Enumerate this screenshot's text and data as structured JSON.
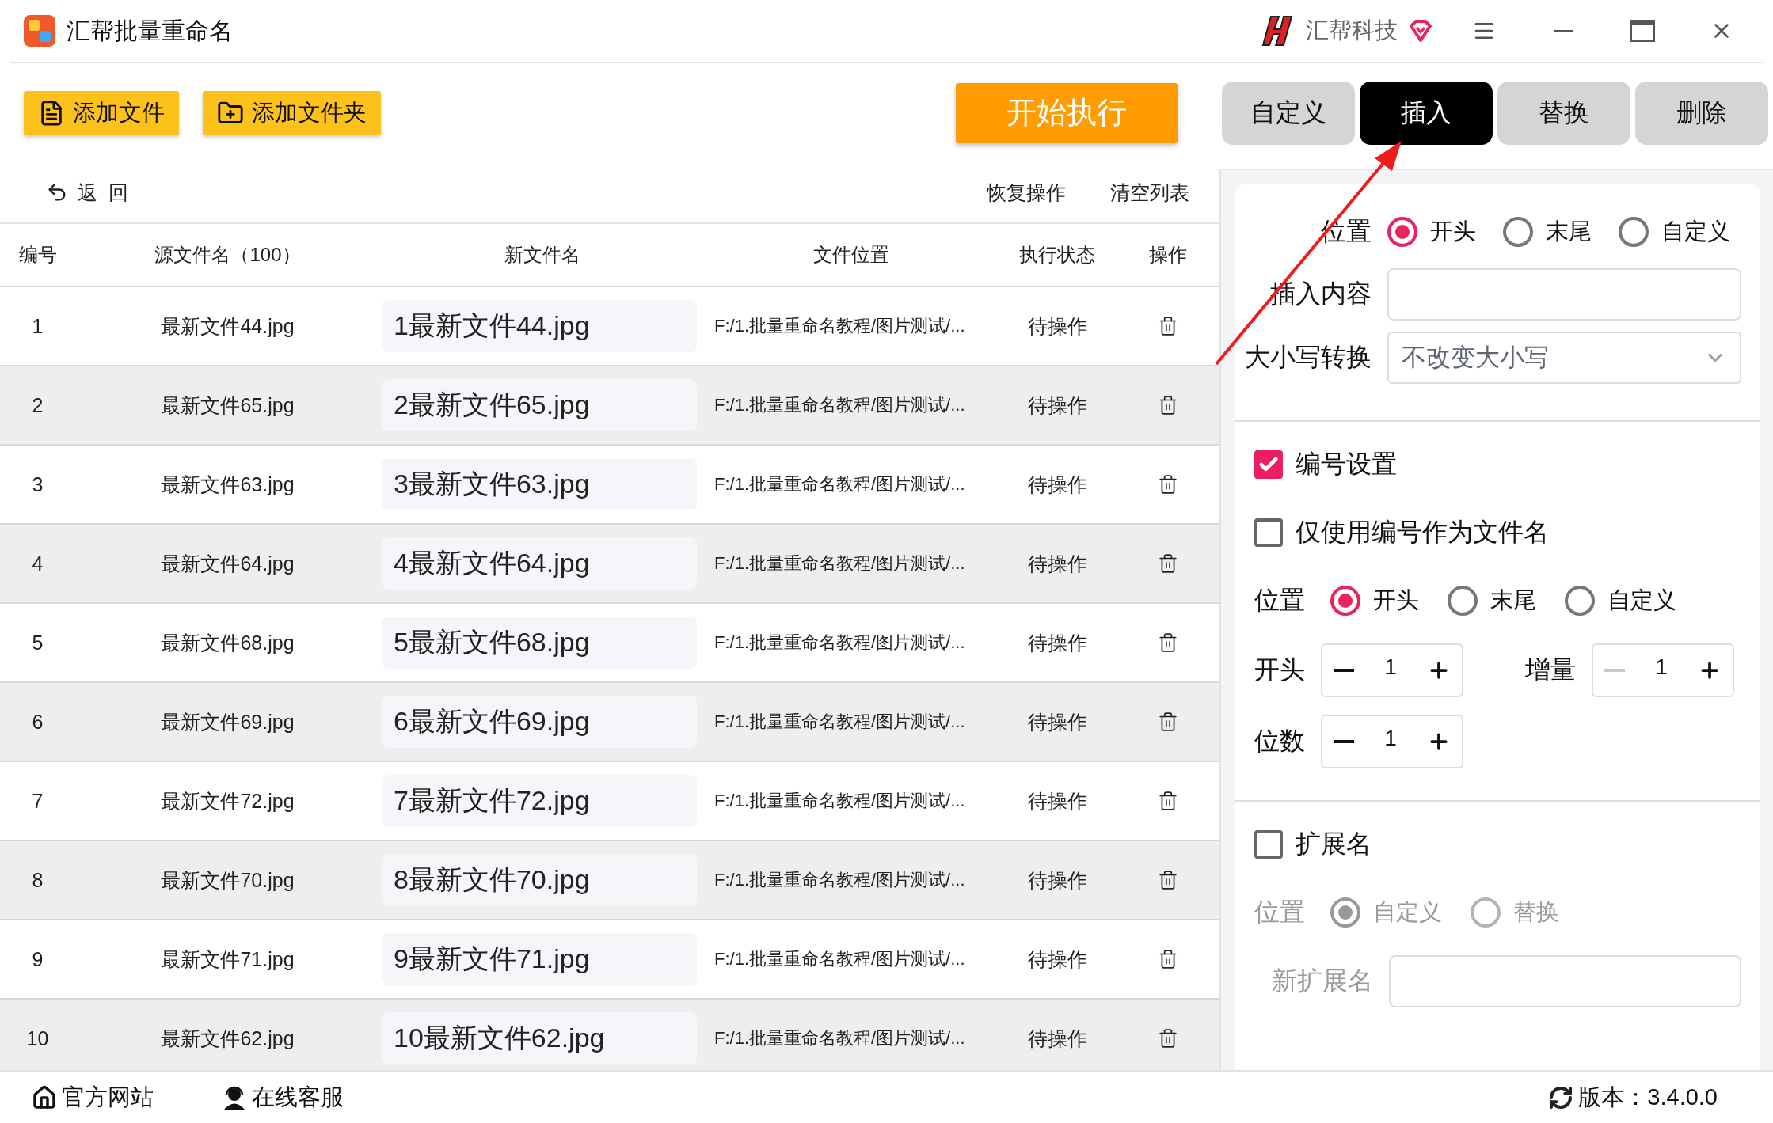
{
  "window": {
    "title": "汇帮批量重命名",
    "brand": "汇帮科技"
  },
  "toolbar": {
    "buttons": [
      "添加文件",
      "添加文件夹"
    ],
    "run_button": "开始执行"
  },
  "mode_tabs": [
    {
      "label": "自定义",
      "selected": false
    },
    {
      "label": "插入",
      "selected": true
    },
    {
      "label": "替换",
      "selected": false
    },
    {
      "label": "删除",
      "selected": false
    }
  ],
  "list_actions": {
    "back": "返  回",
    "undo": "恢复操作",
    "clear": "清空列表"
  },
  "table": {
    "columns": [
      "编号",
      "源文件名（100）",
      "新文件名",
      "文件位置",
      "执行状态",
      "操作"
    ],
    "rows": [
      {
        "index": "1",
        "source": "最新文件44.jpg",
        "new_name": "1最新文件44.jpg",
        "location": "F:/1.批量重命名教程/图片测试/...",
        "status": "待操作"
      },
      {
        "index": "2",
        "source": "最新文件65.jpg",
        "new_name": "2最新文件65.jpg",
        "location": "F:/1.批量重命名教程/图片测试/...",
        "status": "待操作"
      },
      {
        "index": "3",
        "source": "最新文件63.jpg",
        "new_name": "3最新文件63.jpg",
        "location": "F:/1.批量重命名教程/图片测试/...",
        "status": "待操作"
      },
      {
        "index": "4",
        "source": "最新文件64.jpg",
        "new_name": "4最新文件64.jpg",
        "location": "F:/1.批量重命名教程/图片测试/...",
        "status": "待操作"
      },
      {
        "index": "5",
        "source": "最新文件68.jpg",
        "new_name": "5最新文件68.jpg",
        "location": "F:/1.批量重命名教程/图片测试/...",
        "status": "待操作"
      },
      {
        "index": "6",
        "source": "最新文件69.jpg",
        "new_name": "6最新文件69.jpg",
        "location": "F:/1.批量重命名教程/图片测试/...",
        "status": "待操作"
      },
      {
        "index": "7",
        "source": "最新文件72.jpg",
        "new_name": "7最新文件72.jpg",
        "location": "F:/1.批量重命名教程/图片测试/...",
        "status": "待操作"
      },
      {
        "index": "8",
        "source": "最新文件70.jpg",
        "new_name": "8最新文件70.jpg",
        "location": "F:/1.批量重命名教程/图片测试/...",
        "status": "待操作"
      },
      {
        "index": "9",
        "source": "最新文件71.jpg",
        "new_name": "9最新文件71.jpg",
        "location": "F:/1.批量重命名教程/图片测试/...",
        "status": "待操作"
      },
      {
        "index": "10",
        "source": "最新文件62.jpg",
        "new_name": "10最新文件62.jpg",
        "location": "F:/1.批量重命名教程/图片测试/...",
        "status": "待操作"
      }
    ]
  },
  "insert": {
    "position_label": "位置",
    "position": [
      {
        "label": "开头",
        "selected": true
      },
      {
        "label": "末尾",
        "selected": false
      },
      {
        "label": "自定义",
        "selected": false
      }
    ],
    "content_label": "插入内容",
    "case_label": "大小写转换",
    "case_value": "不改变大小写"
  },
  "numbering": {
    "label": "编号设置",
    "checked": true,
    "only_number_label": "仅使用编号作为文件名",
    "only_number_checked": false,
    "position_label": "位置",
    "position": [
      {
        "label": "开头",
        "selected": true
      },
      {
        "label": "末尾",
        "selected": false
      },
      {
        "label": "自定义",
        "selected": false
      }
    ],
    "start": {
      "label": "开头",
      "value": "1",
      "minus_disabled": false
    },
    "increment": {
      "label": "增量",
      "value": "1",
      "minus_disabled": true
    },
    "digits": {
      "label": "位数",
      "value": "1",
      "minus_disabled": false
    }
  },
  "extension": {
    "label": "扩展名",
    "checked": false,
    "position_label": "位置",
    "position": [
      {
        "label": "自定义",
        "selected": true
      },
      {
        "label": "替换",
        "selected": false
      }
    ],
    "new_label": "新扩展名"
  },
  "footer": {
    "links": [
      "官方网站",
      "在线客服"
    ],
    "version": "版本：3.4.0.0"
  }
}
